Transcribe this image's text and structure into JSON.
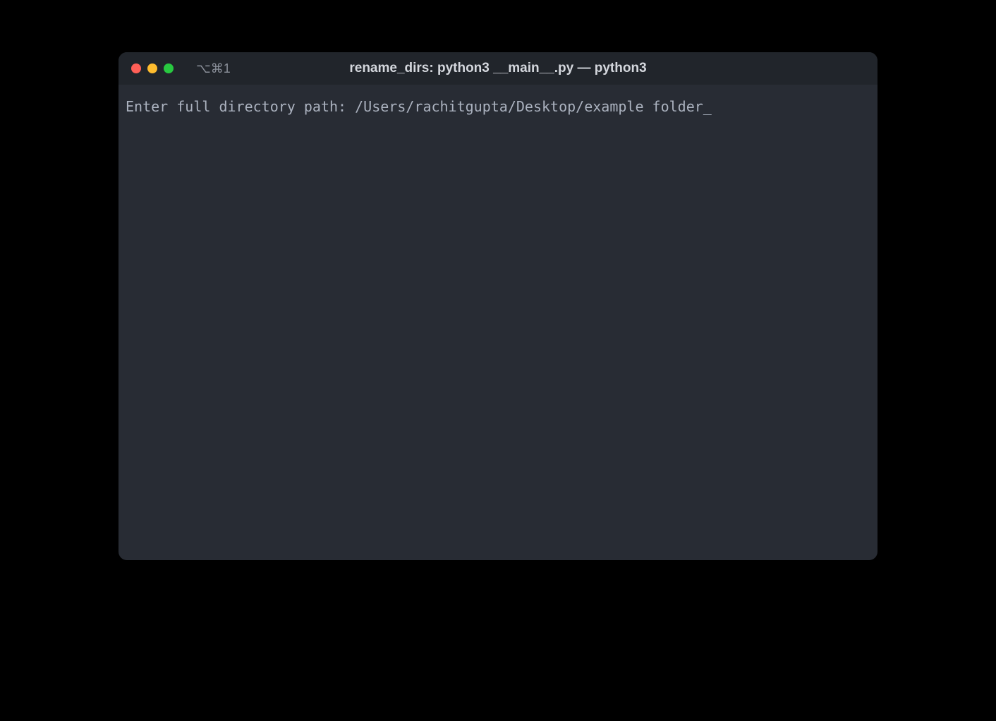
{
  "window": {
    "shortcut": "⌥⌘1",
    "title": "rename_dirs: python3 __main__.py — python3"
  },
  "terminal": {
    "prompt": "Enter full directory path: ",
    "input_value": "/Users/rachitgupta/Desktop/example folder",
    "cursor": "_"
  },
  "colors": {
    "background": "#000000",
    "terminal_bg": "#282C34",
    "titlebar_bg": "#21252B",
    "text": "#ABB2BF",
    "title_text": "#D4D7DD",
    "traffic_red": "#FF5F57",
    "traffic_yellow": "#FEBC2E",
    "traffic_green": "#28C840"
  }
}
